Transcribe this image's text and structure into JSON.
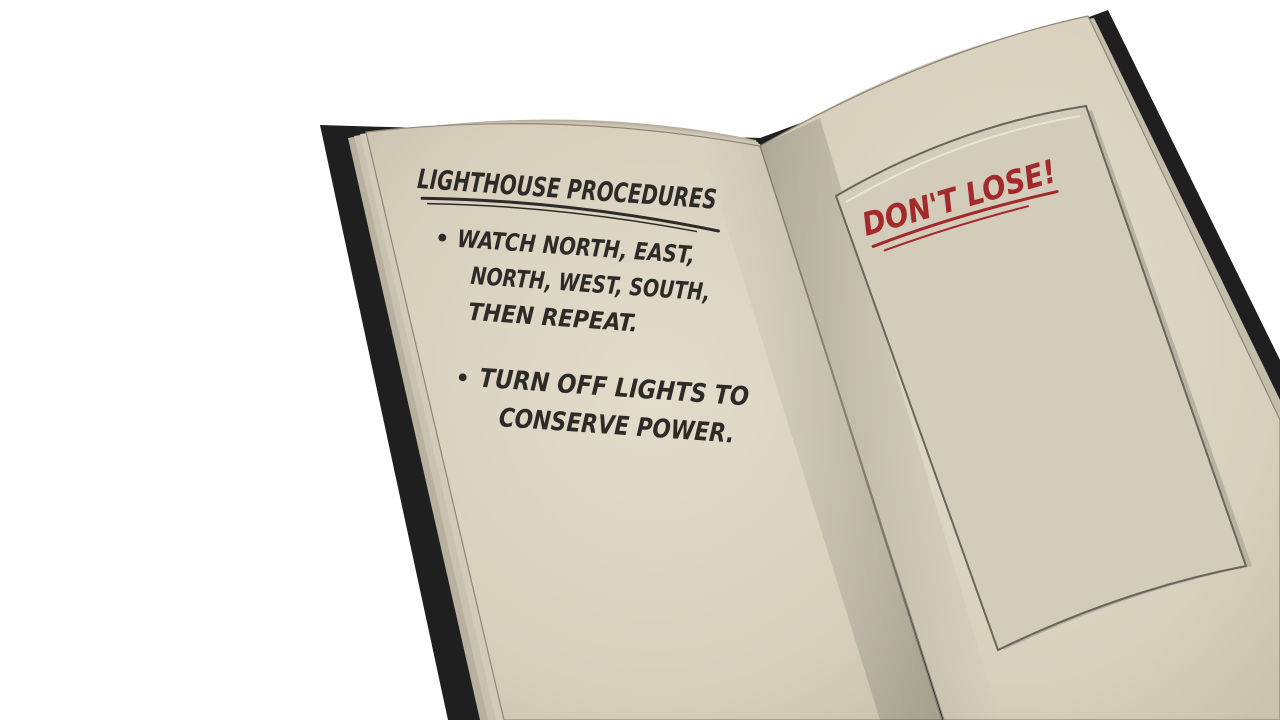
{
  "journal": {
    "left_page": {
      "title": "LIGHTHOUSE PROCEDURES",
      "bullets": [
        {
          "lines": [
            "WATCH NORTH, EAST,",
            "NORTH, WEST, SOUTH,",
            "THEN REPEAT."
          ]
        },
        {
          "lines": [
            "TURN OFF LIGHTS TO",
            "CONSERVE POWER."
          ]
        }
      ]
    },
    "right_page": {
      "note": "DON'T LOSE!"
    }
  },
  "colors": {
    "cover": "#1f1f1f",
    "page": "#dcd5c4",
    "page_edge": "#c9c2b0",
    "ink": "#2d2b28",
    "red_ink": "#a22a2a"
  }
}
